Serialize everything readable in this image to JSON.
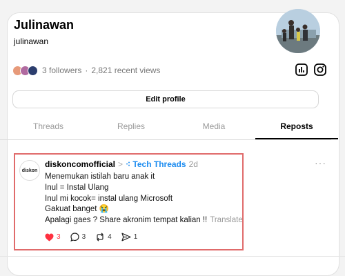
{
  "profile": {
    "name": "Julinawan",
    "handle": "julinawan",
    "followers": "3 followers",
    "views": "2,821 recent views",
    "edit_label": "Edit profile"
  },
  "tabs": [
    {
      "label": "Threads",
      "active": false
    },
    {
      "label": "Replies",
      "active": false
    },
    {
      "label": "Media",
      "active": false
    },
    {
      "label": "Reposts",
      "active": true
    }
  ],
  "post": {
    "avatar_text": "diskon",
    "author": "diskoncomofficial",
    "arrow": ">",
    "topic": "Tech Threads",
    "time": "2d",
    "lines": [
      "Menemukan istilah baru anak it",
      "Inul = Instal Ulang",
      "Inul mi kocok= instal ulang Microsoft",
      "Gakuat banget 😭",
      "Apalagi gaes ? Share akronim tempat kalian !!"
    ],
    "translate": "Translate",
    "likes": "3",
    "replies": "3",
    "reposts": "4",
    "shares": "1"
  },
  "colors": {
    "like": "#ff3040",
    "topic": "#1d8cf0",
    "highlight": "#e06b6b"
  },
  "icons": [
    "insights-icon",
    "instagram-icon",
    "heart-icon",
    "comment-icon",
    "repost-icon",
    "share-icon",
    "more-icon"
  ]
}
